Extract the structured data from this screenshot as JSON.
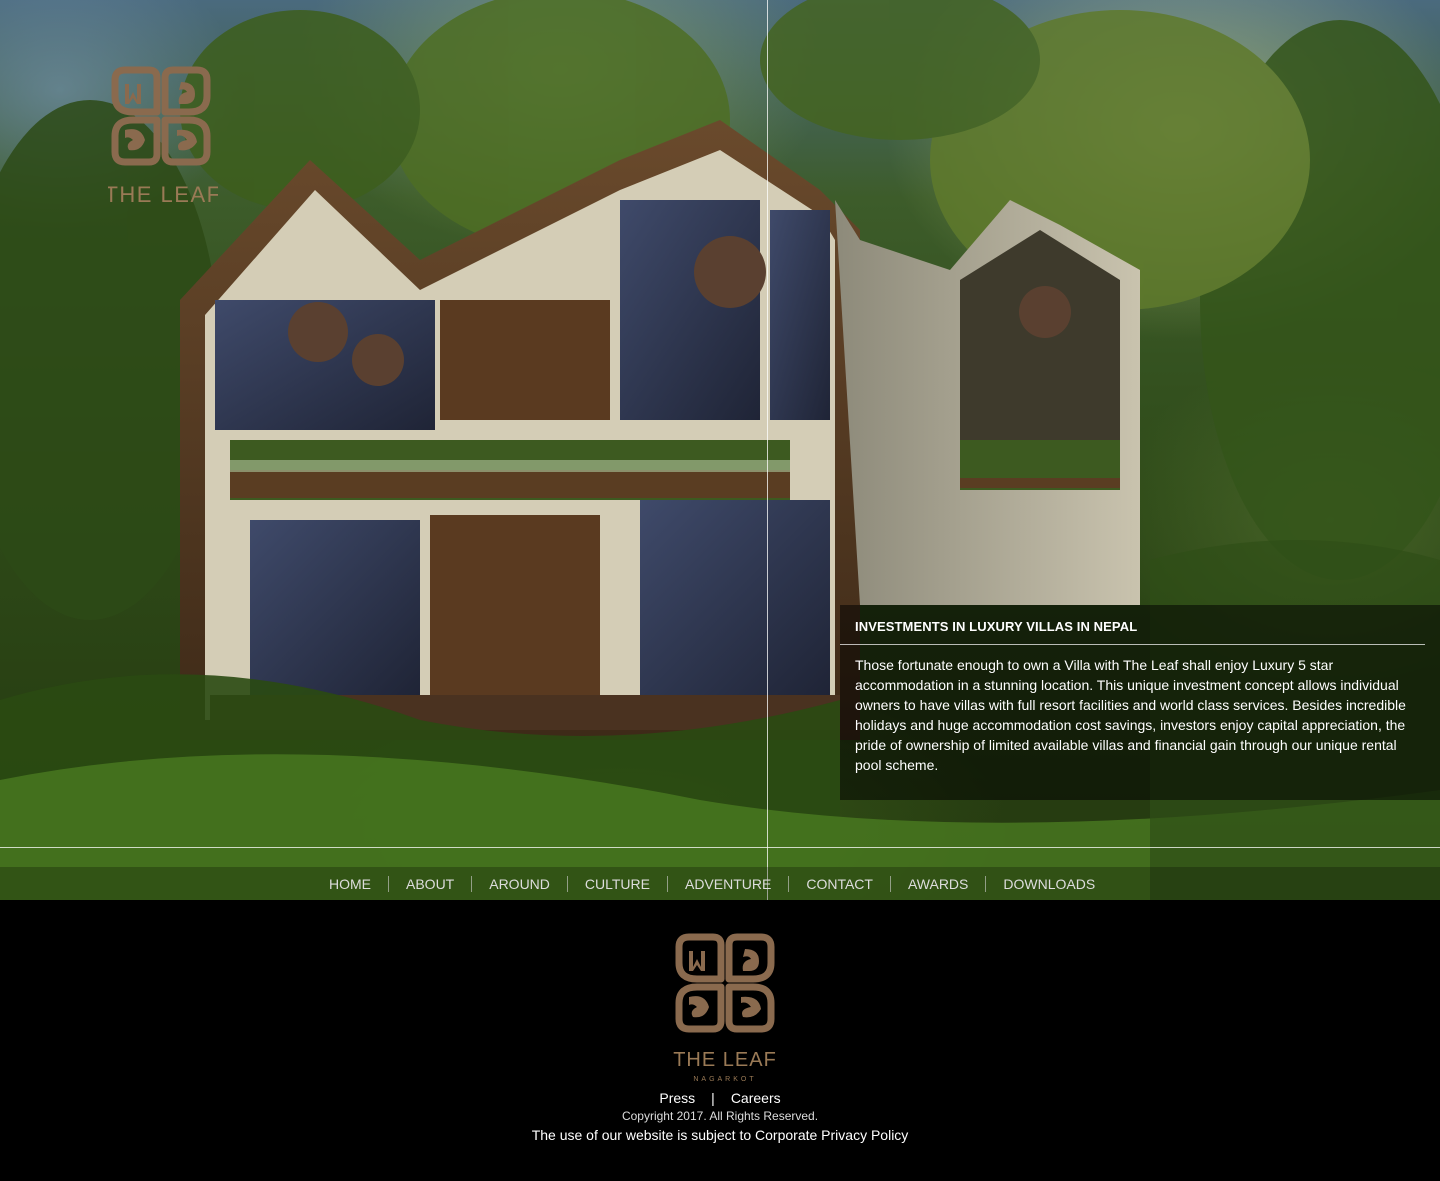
{
  "brand": {
    "name": "THE LEAF",
    "location": "NAGARKOT",
    "logo_color": "#8a6a4e"
  },
  "caption": {
    "title": "INVESTMENTS IN LUXURY VILLAS IN NEPAL",
    "body": "Those fortunate enough to own a Villa with The Leaf shall enjoy Luxury 5 star accommodation in a stunning location. This unique investment concept allows individual owners to have villas with full resort facilities and world class services. Besides incredible holidays and huge accommodation cost savings, investors enjoy capital appreciation, the pride of ownership of limited available villas and financial gain through our unique rental pool scheme."
  },
  "nav": {
    "items": [
      {
        "label": "HOME"
      },
      {
        "label": "ABOUT"
      },
      {
        "label": "AROUND"
      },
      {
        "label": "CULTURE"
      },
      {
        "label": "ADVENTURE"
      },
      {
        "label": "CONTACT"
      },
      {
        "label": "AWARDS"
      },
      {
        "label": "DOWNLOADS"
      }
    ]
  },
  "footer": {
    "press": "Press",
    "separator": "|",
    "careers": "Careers",
    "copyright": "Copyright 2017. All Rights Reserved.",
    "policy": "The use of our website is subject to Corporate Privacy Policy"
  }
}
